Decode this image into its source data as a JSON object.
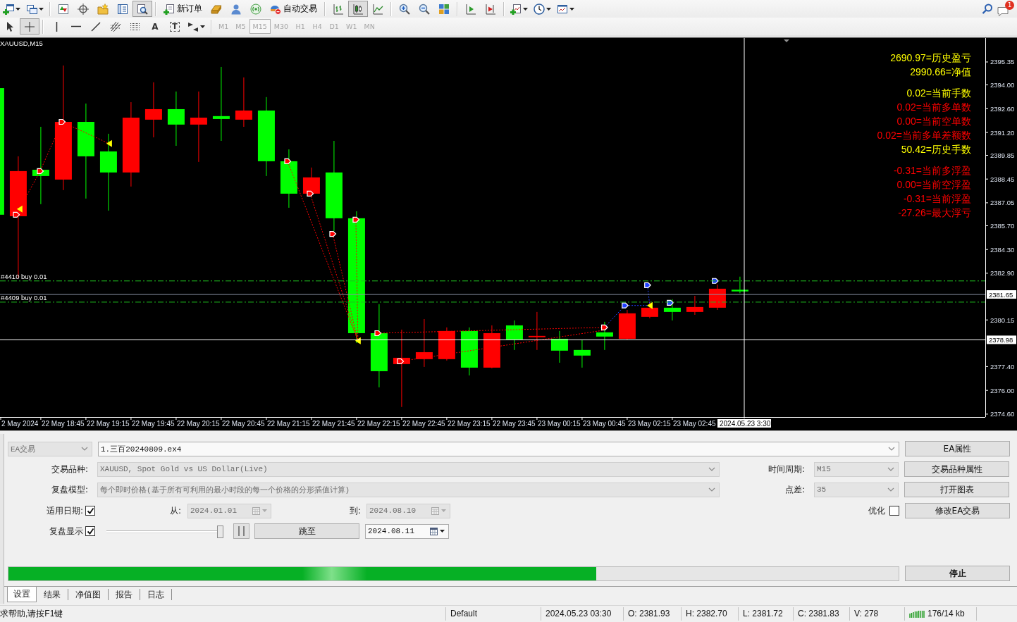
{
  "main_toolbar": {
    "groups": [
      [
        {
          "kind": "icon",
          "selected": false,
          "dropdown": true
        },
        {
          "kind": "icon",
          "selected": false,
          "dropdown": true
        }
      ],
      [
        {
          "kind": "icon",
          "selected": false,
          "dropdown": false
        },
        {
          "kind": "icon",
          "selected": false,
          "dropdown": false
        },
        {
          "kind": "icon",
          "selected": false,
          "dropdown": false
        },
        {
          "kind": "icon",
          "selected": false,
          "dropdown": false
        },
        {
          "kind": "icon",
          "selected": true,
          "dropdown": false
        }
      ],
      [
        {
          "kind": "icon_label",
          "label": "新订单",
          "selected": false,
          "dropdown": false
        },
        {
          "kind": "icon",
          "selected": false,
          "dropdown": false
        },
        {
          "kind": "icon",
          "selected": false,
          "dropdown": false
        },
        {
          "kind": "icon",
          "selected": false,
          "dropdown": false
        },
        {
          "kind": "icon_label",
          "label": "自动交易",
          "selected": false,
          "dropdown": false
        }
      ],
      [
        {
          "kind": "icon",
          "selected": false,
          "dropdown": false
        },
        {
          "kind": "icon",
          "selected": true,
          "dropdown": false
        },
        {
          "kind": "icon",
          "selected": false,
          "dropdown": false
        }
      ],
      [
        {
          "kind": "icon",
          "selected": false,
          "dropdown": false
        },
        {
          "kind": "icon",
          "selected": false,
          "dropdown": false
        },
        {
          "kind": "icon",
          "selected": false,
          "dropdown": false
        }
      ],
      [
        {
          "kind": "icon",
          "selected": false,
          "dropdown": false
        },
        {
          "kind": "icon",
          "selected": false,
          "dropdown": false
        }
      ],
      [
        {
          "kind": "icon",
          "selected": false,
          "dropdown": true
        },
        {
          "kind": "icon",
          "selected": false,
          "dropdown": true
        },
        {
          "kind": "icon",
          "selected": false,
          "dropdown": true
        }
      ]
    ],
    "notification_count": "1"
  },
  "drawing_toolbar": {
    "groups": [
      [
        {
          "kind": "icon",
          "selected": false,
          "dropdown": false
        },
        {
          "kind": "icon",
          "selected": true,
          "dropdown": false
        }
      ],
      [
        {
          "kind": "icon",
          "selected": false,
          "dropdown": false
        },
        {
          "kind": "icon",
          "selected": false,
          "dropdown": false
        },
        {
          "kind": "icon",
          "selected": false,
          "dropdown": false
        },
        {
          "kind": "icon",
          "selected": false,
          "dropdown": false
        },
        {
          "kind": "icon",
          "selected": false,
          "dropdown": false
        },
        {
          "kind": "letter",
          "label": "A",
          "selected": false,
          "dropdown": false
        },
        {
          "kind": "framed_letter",
          "label": "T",
          "selected": false,
          "dropdown": false
        },
        {
          "kind": "icon",
          "selected": false,
          "dropdown": true
        }
      ]
    ],
    "periods": [
      {
        "label": "M1",
        "selected": false,
        "disabled": true
      },
      {
        "label": "M5",
        "selected": false,
        "disabled": true
      },
      {
        "label": "M15",
        "selected": true,
        "disabled": true
      },
      {
        "label": "M30",
        "selected": false,
        "disabled": true
      },
      {
        "label": "H1",
        "selected": false,
        "disabled": true
      },
      {
        "label": "H4",
        "selected": false,
        "disabled": true
      },
      {
        "label": "D1",
        "selected": false,
        "disabled": true
      },
      {
        "label": "W1",
        "selected": false,
        "disabled": true
      },
      {
        "label": "MN",
        "selected": false,
        "disabled": true
      }
    ]
  },
  "chart": {
    "title": "XAUUSD,M15",
    "price_axis": [
      "2395.35",
      "2394.00",
      "2392.60",
      "2391.20",
      "2389.85",
      "2388.45",
      "2387.05",
      "2385.70",
      "2384.30",
      "2382.90",
      "2380.15",
      "2377.40",
      "2376.00",
      "2374.60"
    ],
    "time_axis": [
      "2 May 2024",
      "22 May 18:45",
      "22 May 19:15",
      "22 May 19:45",
      "22 May 20:15",
      "22 May 20:45",
      "22 May 21:15",
      "22 May 21:45",
      "22 May 22:15",
      "22 May 22:45",
      "22 May 23:15",
      "22 May 23:45",
      "23 May 00:15",
      "23 May 00:45",
      "23 May 02:15",
      "23 May 02:45"
    ],
    "order_lines": [
      "#4410 buy 0.01",
      "#4409 buy 0.01"
    ],
    "bid_price": "2381.65",
    "crosshair": {
      "price": "2378.98",
      "time": "2024.05.23 3:30"
    },
    "info_panel": {
      "groups": [
        [
          {
            "text": "2690.97=历史盈亏",
            "color": "#ffff00"
          },
          {
            "text": "2990.66=净值",
            "color": "#ffff00"
          }
        ],
        [
          {
            "text": "0.02=当前手数",
            "color": "#ffff00"
          },
          {
            "text": "0.02=当前多单数",
            "color": "#ff0000"
          },
          {
            "text": "0.00=当前空单数",
            "color": "#ff0000"
          },
          {
            "text": "0.02=当前多单差额数",
            "color": "#ff0000"
          },
          {
            "text": "50.42=历史手数",
            "color": "#ffff00"
          }
        ],
        [
          {
            "text": "-0.31=当前多浮盈",
            "color": "#ff0000"
          },
          {
            "text": "0.00=当前空浮盈",
            "color": "#ff0000"
          },
          {
            "text": "-0.31=当前浮盈",
            "color": "#ff0000"
          },
          {
            "text": "-27.26=最大浮亏",
            "color": "#ff0000"
          }
        ]
      ]
    }
  },
  "tester": {
    "program_type": {
      "value": "EA交易",
      "disabled": true
    },
    "expert": {
      "value": "1.三百20240809.ex4",
      "disabled": false
    },
    "symbol": {
      "label": "交易品种:",
      "value": "XAUUSD, Spot Gold vs US Dollar(Live)",
      "disabled": true
    },
    "period": {
      "label": "时间周期:",
      "value": "M15",
      "disabled": true
    },
    "model": {
      "label": "复盘模型:",
      "value": "每个即时价格(基于所有可利用的最小时段的每一个价格的分形插值计算)",
      "disabled": true
    },
    "spread": {
      "label": "点差:",
      "value": "35",
      "disabled": true
    },
    "use_date": {
      "label": "适用日期:",
      "checked": true
    },
    "date_from": {
      "label": "从:",
      "value": "2024.01.01",
      "disabled": true
    },
    "date_to": {
      "label": "到:",
      "value": "2024.08.10",
      "disabled": true
    },
    "optimization": {
      "label": "优化",
      "checked": false
    },
    "visual_mode": {
      "label": "复盘显示",
      "checked": true
    },
    "speed_slider": {
      "level": 1
    },
    "skip_to_button": "跳至",
    "skip_to_date": {
      "value": "2024.08.11",
      "disabled": false
    },
    "side_buttons": [
      "EA属性",
      "交易品种属性",
      "打开图表",
      "修改EA交易"
    ],
    "progress": {
      "level": 0.66
    },
    "stop_button": "停止"
  },
  "tabs": [
    {
      "label": "设置",
      "selected": true
    },
    {
      "label": "结果",
      "selected": false
    },
    {
      "label": "净值图",
      "selected": false
    },
    {
      "label": "报告",
      "selected": false
    },
    {
      "label": "日志",
      "selected": false
    }
  ],
  "status_bar": {
    "help": "求帮助,请按F1键",
    "sections": [
      "Default",
      "2024.05.23 03:30",
      "O: 2381.93",
      "H: 2382.70",
      "L: 2381.72",
      "C: 2381.83",
      "V: 278"
    ],
    "traffic": "176/14 kb"
  }
}
